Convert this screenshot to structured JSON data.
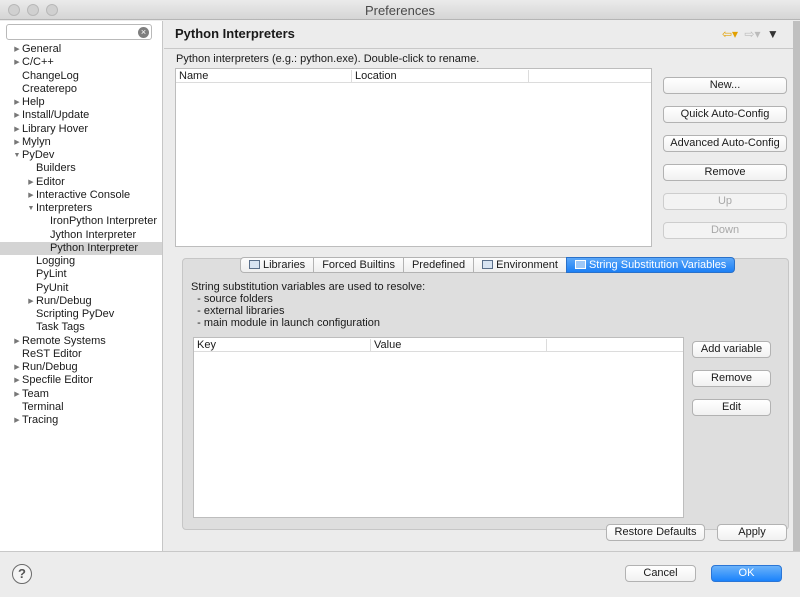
{
  "window": {
    "title": "Preferences"
  },
  "sidebar": {
    "filter_value": "",
    "tree": [
      {
        "label": "General",
        "level": 0,
        "twisty": "collapsed"
      },
      {
        "label": "C/C++",
        "level": 0,
        "twisty": "collapsed"
      },
      {
        "label": "ChangeLog",
        "level": 0,
        "twisty": "none"
      },
      {
        "label": "Createrepo",
        "level": 0,
        "twisty": "none"
      },
      {
        "label": "Help",
        "level": 0,
        "twisty": "collapsed"
      },
      {
        "label": "Install/Update",
        "level": 0,
        "twisty": "collapsed"
      },
      {
        "label": "Library Hover",
        "level": 0,
        "twisty": "collapsed"
      },
      {
        "label": "Mylyn",
        "level": 0,
        "twisty": "collapsed"
      },
      {
        "label": "PyDev",
        "level": 0,
        "twisty": "expanded"
      },
      {
        "label": "Builders",
        "level": 1,
        "twisty": "none"
      },
      {
        "label": "Editor",
        "level": 1,
        "twisty": "collapsed"
      },
      {
        "label": "Interactive Console",
        "level": 1,
        "twisty": "collapsed"
      },
      {
        "label": "Interpreters",
        "level": 1,
        "twisty": "expanded"
      },
      {
        "label": "IronPython Interpreter",
        "level": 2,
        "twisty": "none"
      },
      {
        "label": "Jython Interpreter",
        "level": 2,
        "twisty": "none"
      },
      {
        "label": "Python Interpreter",
        "level": 2,
        "twisty": "none",
        "selected": true
      },
      {
        "label": "Logging",
        "level": 1,
        "twisty": "none"
      },
      {
        "label": "PyLint",
        "level": 1,
        "twisty": "none"
      },
      {
        "label": "PyUnit",
        "level": 1,
        "twisty": "none"
      },
      {
        "label": "Run/Debug",
        "level": 1,
        "twisty": "collapsed"
      },
      {
        "label": "Scripting PyDev",
        "level": 1,
        "twisty": "none"
      },
      {
        "label": "Task Tags",
        "level": 1,
        "twisty": "none"
      },
      {
        "label": "Remote Systems",
        "level": 0,
        "twisty": "collapsed"
      },
      {
        "label": "ReST Editor",
        "level": 0,
        "twisty": "none"
      },
      {
        "label": "Run/Debug",
        "level": 0,
        "twisty": "collapsed"
      },
      {
        "label": "Specfile Editor",
        "level": 0,
        "twisty": "collapsed"
      },
      {
        "label": "Team",
        "level": 0,
        "twisty": "collapsed"
      },
      {
        "label": "Terminal",
        "level": 0,
        "twisty": "none"
      },
      {
        "label": "Tracing",
        "level": 0,
        "twisty": "collapsed"
      }
    ]
  },
  "page": {
    "title": "Python Interpreters",
    "description": "Python interpreters (e.g.: python.exe).   Double-click to rename.",
    "interpreters_table": {
      "columns": [
        "Name",
        "Location"
      ],
      "rows": []
    },
    "buttons": {
      "new": "New...",
      "quick_auto_config": "Quick Auto-Config",
      "advanced_auto_config": "Advanced Auto-Config",
      "remove": "Remove",
      "up": "Up",
      "down": "Down"
    },
    "tabs": [
      {
        "label": "Libraries",
        "icon": "libraries-icon",
        "active": false
      },
      {
        "label": "Forced Builtins",
        "icon": "",
        "active": false
      },
      {
        "label": "Predefined",
        "icon": "",
        "active": false
      },
      {
        "label": "Environment",
        "icon": "environment-icon",
        "active": false
      },
      {
        "label": "String Substitution Variables",
        "icon": "variables-icon",
        "active": true
      }
    ],
    "ssv": {
      "description_lines": [
        "String substitution variables are used to resolve:",
        "  - source folders",
        "  - external libraries",
        "  - main module in launch configuration"
      ],
      "table": {
        "columns": [
          "Key",
          "Value"
        ],
        "rows": []
      },
      "buttons": {
        "add_variable": "Add variable",
        "remove": "Remove",
        "edit": "Edit"
      }
    },
    "restore_defaults": "Restore Defaults",
    "apply": "Apply"
  },
  "footer": {
    "help_glyph": "?",
    "cancel": "Cancel",
    "ok": "OK"
  },
  "colors": {
    "accent": "#1a82fb",
    "selection": "#d4d4d4",
    "nav_arrow": "#e2a000"
  }
}
